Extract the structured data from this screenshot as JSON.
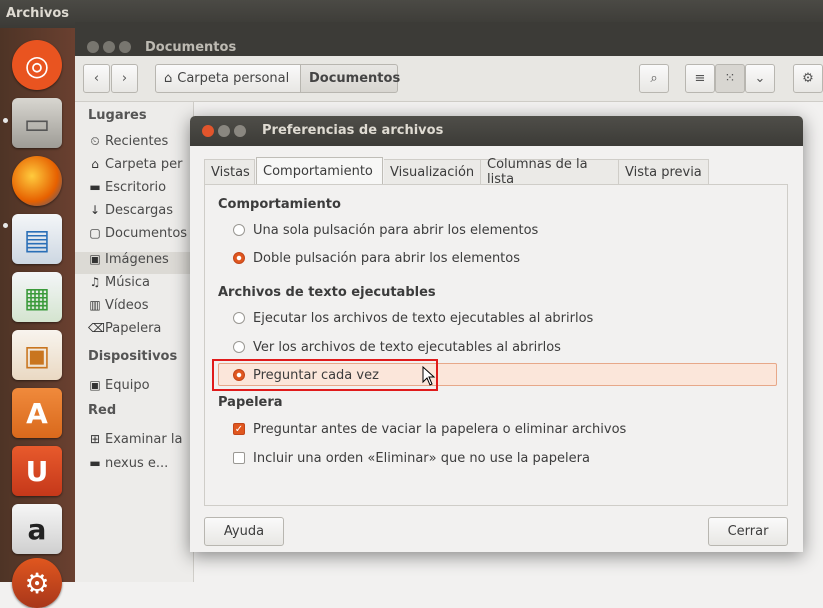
{
  "top_panel": {
    "title": "Archivos"
  },
  "launcher": {
    "items": [
      {
        "name": "ubuntu-dash-icon",
        "glyph": "◎",
        "color": "#e95420"
      },
      {
        "name": "files-icon",
        "glyph": "▭",
        "color": "#8a8a85"
      },
      {
        "name": "firefox-icon",
        "glyph": "●",
        "color": "#e66000"
      },
      {
        "name": "writer-icon",
        "glyph": "▤",
        "color": "#2a6fb7"
      },
      {
        "name": "calc-icon",
        "glyph": "▦",
        "color": "#3a9a3a"
      },
      {
        "name": "impress-icon",
        "glyph": "▣",
        "color": "#c9751f"
      },
      {
        "name": "software-center-icon",
        "glyph": "A",
        "color": "#d9691c"
      },
      {
        "name": "ubuntu-one-icon",
        "glyph": "U",
        "color": "#d33c1d"
      },
      {
        "name": "amazon-icon",
        "glyph": "a",
        "color": "#4a4a4a"
      },
      {
        "name": "settings-launcher-icon",
        "glyph": "⚙",
        "color": "#c0451c"
      }
    ]
  },
  "nautilus": {
    "window_title": "Documentos",
    "path": [
      "Carpeta personal",
      "Documentos"
    ],
    "sidebar": {
      "places_header": "Lugares",
      "places": [
        {
          "icon": "⏲",
          "label": "Recientes"
        },
        {
          "icon": "⌂",
          "label": "Carpeta per"
        },
        {
          "icon": "▬",
          "label": "Escritorio"
        },
        {
          "icon": "↓",
          "label": "Descargas"
        },
        {
          "icon": "▢",
          "label": "Documentos"
        },
        {
          "icon": "▣",
          "label": "Imágenes"
        },
        {
          "icon": "♫",
          "label": "Música"
        },
        {
          "icon": "▥",
          "label": "Vídeos"
        },
        {
          "icon": "⌫",
          "label": "Papelera"
        }
      ],
      "devices_header": "Dispositivos",
      "devices": [
        {
          "icon": "▣",
          "label": "Equipo"
        }
      ],
      "network_header": "Red",
      "network": [
        {
          "icon": "⊞",
          "label": "Examinar la"
        },
        {
          "icon": "▬",
          "label": "nexus e..."
        }
      ]
    }
  },
  "dialog": {
    "title": "Preferencias de archivos",
    "tabs": [
      "Vistas",
      "Comportamiento",
      "Visualización",
      "Columnas de la lista",
      "Vista previa"
    ],
    "active_tab": 1,
    "behavior_header": "Comportamiento",
    "behavior_options": [
      "Una sola pulsación para abrir los elementos",
      "Doble pulsación para abrir los elementos"
    ],
    "executable_header": "Archivos de texto ejecutables",
    "executable_options": [
      "Ejecutar los archivos de texto ejecutables al abrirlos",
      "Ver los archivos de texto ejecutables al abrirlos",
      "Preguntar cada vez"
    ],
    "trash_header": "Papelera",
    "trash_options": [
      "Preguntar antes de vaciar la papelera o eliminar archivos",
      "Incluir una orden «Eliminar» que no use la papelera"
    ],
    "help_button": "Ayuda",
    "close_button": "Cerrar"
  },
  "colors": {
    "accent": "#e0571f",
    "highlight_box": "#e01b1b"
  }
}
